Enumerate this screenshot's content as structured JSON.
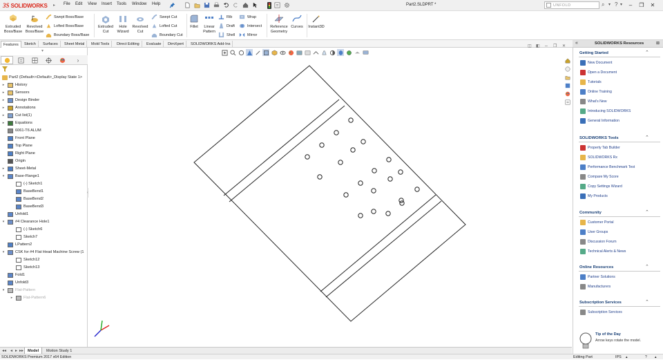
{
  "app": {
    "logo_ds": "3S",
    "logo_text": "SOLIDWORKS",
    "document_title": "Part2.SLDPRT *"
  },
  "menus": [
    "File",
    "Edit",
    "View",
    "Insert",
    "Tools",
    "Window",
    "Help"
  ],
  "search": {
    "placeholder": "UNFOLD"
  },
  "ribbon": {
    "extruded_boss": "Extruded\nBoss/Base",
    "revolved_boss": "Revolved\nBoss/Base",
    "swept_boss": "Swept Boss/Base",
    "lofted_boss": "Lofted Boss/Base",
    "boundary_boss": "Boundary Boss/Base",
    "extruded_cut": "Extruded\nCut",
    "hole_wizard": "Hole\nWizard",
    "revolved_cut": "Revolved\nCut",
    "swept_cut": "Swept Cut",
    "lofted_cut": "Lofted Cut",
    "boundary_cut": "Boundary Cut",
    "fillet": "Fillet",
    "linear_pattern": "Linear\nPattern",
    "rib": "Rib",
    "draft": "Draft",
    "shell": "Shell",
    "wrap": "Wrap",
    "intersect": "Intersect",
    "mirror": "Mirror",
    "reference_geometry": "Reference\nGeometry",
    "curves": "Curves",
    "instant3d": "Instant3D"
  },
  "command_tabs": [
    "Features",
    "Sketch",
    "Surfaces",
    "Sheet Metal",
    "Mold Tools",
    "Direct Editing",
    "Evaluate",
    "DimXpert",
    "SOLIDWORKS Add-Ins"
  ],
  "tree": {
    "root": "Part2  (Default<<Default>_Display State 1>",
    "items": [
      {
        "label": "History",
        "icon": "folder-icon",
        "arrow": "▸"
      },
      {
        "label": "Sensors",
        "icon": "folder-icon",
        "arrow": "▸"
      },
      {
        "label": "Design Binder",
        "icon": "binder-icon",
        "arrow": "▸"
      },
      {
        "label": "Annotations",
        "icon": "annotation-icon",
        "arrow": "▸"
      },
      {
        "label": "Cut list(1)",
        "icon": "cutlist-icon",
        "arrow": "▸"
      },
      {
        "label": "Equations",
        "icon": "equation-icon",
        "arrow": "▸"
      },
      {
        "label": "6061-T6 ALUM",
        "icon": "material-icon",
        "arrow": ""
      },
      {
        "label": "Front Plane",
        "icon": "plane-icon",
        "arrow": ""
      },
      {
        "label": "Top Plane",
        "icon": "plane-icon",
        "arrow": ""
      },
      {
        "label": "Right Plane",
        "icon": "plane-icon",
        "arrow": ""
      },
      {
        "label": "Origin",
        "icon": "origin-icon",
        "arrow": ""
      },
      {
        "label": "Sheet-Metal",
        "icon": "sheetmetal-icon",
        "arrow": "▸"
      },
      {
        "label": "Base-Flange1",
        "icon": "flange-icon",
        "arrow": "▾"
      },
      {
        "label": "(-) Sketch1",
        "icon": "sketch-icon",
        "arrow": "",
        "indent": 1
      },
      {
        "label": "BaseBend1",
        "icon": "bend-icon",
        "arrow": "",
        "indent": 1
      },
      {
        "label": "BaseBend2",
        "icon": "bend-icon",
        "arrow": "",
        "indent": 1
      },
      {
        "label": "BaseBend3",
        "icon": "bend-icon",
        "arrow": "",
        "indent": 1
      },
      {
        "label": "Unfold1",
        "icon": "unfold-icon",
        "arrow": ""
      },
      {
        "label": "#4 Clearance Hole1",
        "icon": "hole-icon",
        "arrow": "▾"
      },
      {
        "label": "(-) Sketch6",
        "icon": "sketch-icon",
        "arrow": "",
        "indent": 1
      },
      {
        "label": "Sketch7",
        "icon": "sketch-icon",
        "arrow": "",
        "indent": 1
      },
      {
        "label": "LPattern2",
        "icon": "pattern-icon",
        "arrow": ""
      },
      {
        "label": "CSK for #4 Flat Head Machine Screw (1",
        "icon": "hole-icon",
        "arrow": "▾"
      },
      {
        "label": "Sketch12",
        "icon": "sketch-icon",
        "arrow": "",
        "indent": 1
      },
      {
        "label": "Sketch13",
        "icon": "sketch-icon",
        "arrow": "",
        "indent": 1
      },
      {
        "label": "Fold1",
        "icon": "fold-icon",
        "arrow": ""
      },
      {
        "label": "Unfold3",
        "icon": "unfold-icon",
        "arrow": ""
      },
      {
        "label": "Flat-Pattern",
        "icon": "flatpattern-icon",
        "arrow": "▾",
        "dim": true
      },
      {
        "label": "Flat-Pattern6",
        "icon": "flatpattern-icon",
        "arrow": "▸",
        "indent": 1,
        "dim": true
      }
    ]
  },
  "bottom_tabs": [
    "Model",
    "Motion Study 1"
  ],
  "status": {
    "left": "SOLIDWORKS Premium 2017 x64 Edition",
    "mode": "Editing Part",
    "units": "IPS"
  },
  "resources": {
    "title": "SOLIDWORKS Resources",
    "sections": [
      {
        "heading": "Getting Started",
        "items": [
          "New Document",
          "Open a Document",
          "Tutorials",
          "Online Training",
          "What's New",
          "Introducing SOLIDWORKS",
          "General Information"
        ]
      },
      {
        "heading": "SOLIDWORKS Tools",
        "items": [
          "Property Tab Builder",
          "SOLIDWORKS Rx",
          "Performance Benchmark Test",
          "Compare My Score",
          "Copy Settings Wizard",
          "My Products"
        ]
      },
      {
        "heading": "Community",
        "items": [
          "Customer Portal",
          "User Groups",
          "Discussion Forum",
          "Technical Alerts & News"
        ]
      },
      {
        "heading": "Online Resources",
        "items": [
          "Partner Solutions",
          "Manufacturers"
        ]
      },
      {
        "heading": "Subscription Services",
        "items": [
          "Subscription Services"
        ]
      }
    ],
    "tip_title": "Tip of the Day",
    "tip_text": "Arrow keys rotate the model."
  },
  "colors": {
    "brand": "#da291c",
    "link": "#1f3e8a",
    "heading": "#163d74"
  }
}
